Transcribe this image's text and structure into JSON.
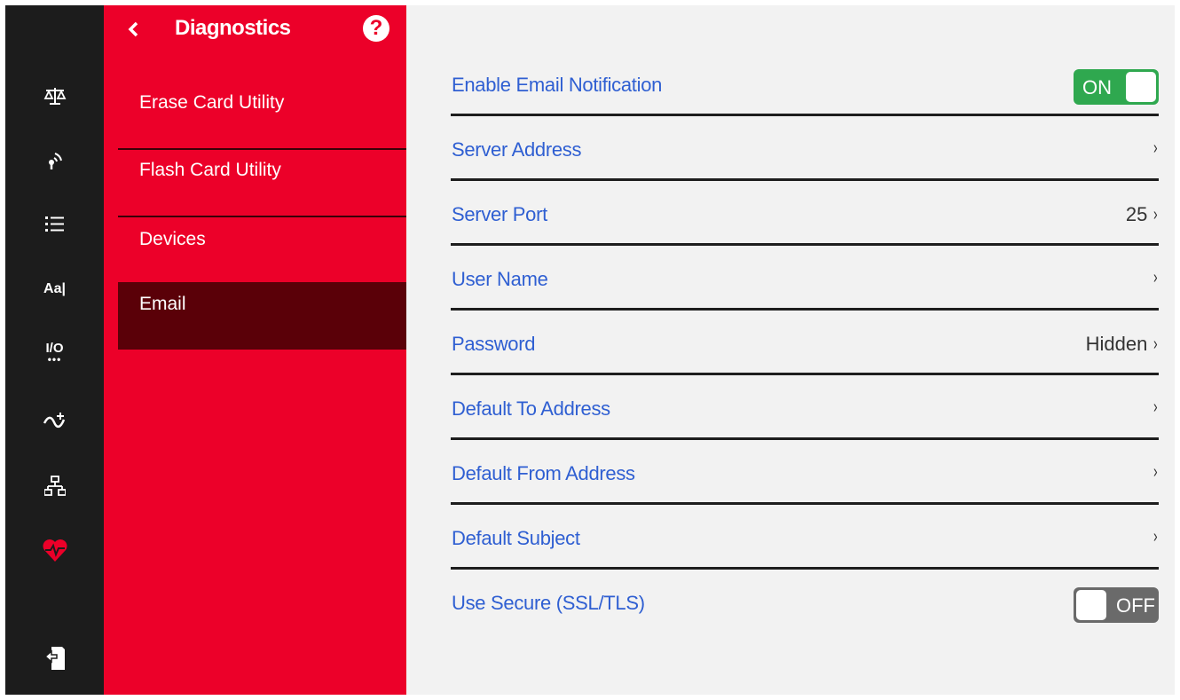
{
  "menu": {
    "title": "Diagnostics",
    "help_glyph": "?",
    "items": [
      {
        "label": "Erase Card Utility"
      },
      {
        "label": "Flash Card Utility"
      },
      {
        "label": "Devices"
      },
      {
        "label": "Email"
      }
    ]
  },
  "rail": {
    "items": [
      "scale-icon",
      "wireless-icon",
      "list-icon",
      "font-icon",
      "io-icon",
      "flow-icon",
      "network-icon",
      "heart-pulse-icon",
      "export-icon"
    ],
    "font_label": "Aa|",
    "io_label": "I/O"
  },
  "settings": {
    "rows": [
      {
        "label": "Enable Email Notification",
        "control": "toggle",
        "toggle_text": "ON"
      },
      {
        "label": "Server Address",
        "value": ""
      },
      {
        "label": "Server Port",
        "value": "25"
      },
      {
        "label": "User Name",
        "value": ""
      },
      {
        "label": "Password",
        "value": "Hidden"
      },
      {
        "label": "Default To Address",
        "value": ""
      },
      {
        "label": "Default From Address",
        "value": ""
      },
      {
        "label": "Default Subject",
        "value": ""
      },
      {
        "label": "Use Secure (SSL/TLS)",
        "control": "toggle",
        "toggle_text": "OFF"
      }
    ],
    "chevron": "›"
  },
  "colors": {
    "rail_bg": "#1c1c1c",
    "menu_bg": "#ec0029",
    "menu_active": "#5a0008",
    "content_bg": "#f2f2f2",
    "label_blue": "#2f5fd2",
    "toggle_on": "#2fa84f",
    "toggle_off": "#6a6a6a"
  }
}
